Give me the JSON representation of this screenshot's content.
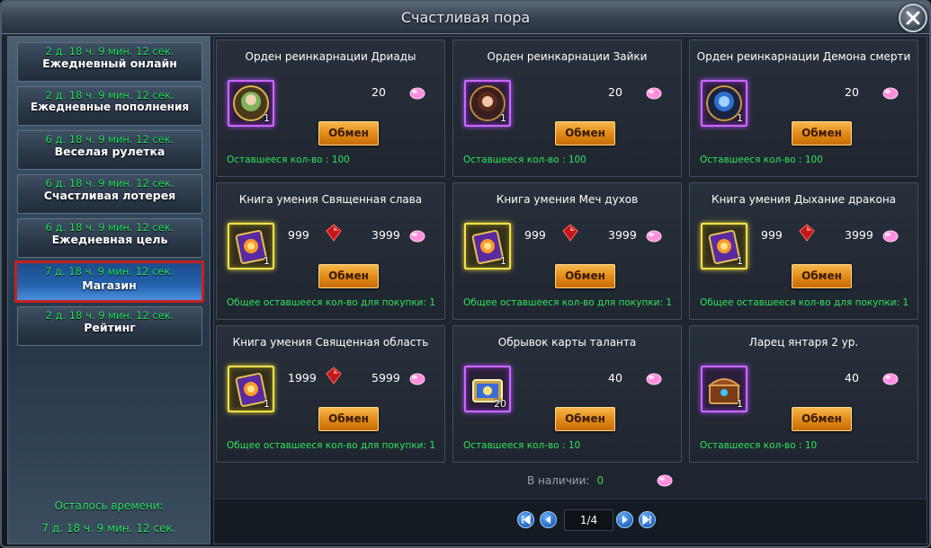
{
  "window": {
    "title": "Счастливая пора"
  },
  "sidebar": {
    "items": [
      {
        "timer": "2 д. 18 ч. 9 мин. 12 сек.",
        "label": "Ежедневный онлайн"
      },
      {
        "timer": "2 д. 18 ч. 9 мин. 12 сек.",
        "label": "Ежедневные пополнения"
      },
      {
        "timer": "6 д. 18 ч. 9 мин. 12 сек.",
        "label": "Веселая рулетка"
      },
      {
        "timer": "6 д. 18 ч. 9 мин. 12 сек.",
        "label": "Счастливая лотерея"
      },
      {
        "timer": "6 д. 18 ч. 9 мин. 12 сек.",
        "label": "Ежедневная цель"
      },
      {
        "timer": "7 д. 18 ч. 9 мин. 12 сек.",
        "label": "Магазин"
      },
      {
        "timer": "2 д. 18 ч. 9 мин. 12 сек.",
        "label": "Рейтинг"
      }
    ],
    "active_index": 5,
    "remaining_label": "Осталось времени:",
    "remaining_value": "7 д. 18 ч. 9 мин. 12 сек."
  },
  "shop": {
    "exchange_label": "Обмен",
    "cards": [
      {
        "title": "Орден реинкарнации Дриады",
        "qty": "1",
        "price_gem": "20",
        "footer": "Оставшееся кол-во : 100",
        "frame": "purple",
        "icon": "dryad-medal-icon"
      },
      {
        "title": "Орден реинкарнации Зайки",
        "qty": "1",
        "price_gem": "20",
        "footer": "Оставшееся кол-во : 100",
        "frame": "purple",
        "icon": "bunny-medal-icon"
      },
      {
        "title": "Орден реинкарнации Демона смерти",
        "qty": "1",
        "price_gem": "20",
        "footer": "Оставшееся кол-во : 100",
        "frame": "purple",
        "icon": "death-demon-medal-icon"
      },
      {
        "title": "Книга умения Священная слава",
        "qty": "1",
        "price_red": "999",
        "price_gem": "3999",
        "footer": "Общее оставшееся кол-во для покупки: 1",
        "frame": "gold",
        "icon": "skill-book-icon"
      },
      {
        "title": "Книга умения Меч духов",
        "qty": "1",
        "price_red": "999",
        "price_gem": "3999",
        "footer": "Общее оставшееся кол-во для покупки: 1",
        "frame": "gold",
        "icon": "skill-book-icon"
      },
      {
        "title": "Книга умения Дыхание дракона",
        "qty": "1",
        "price_red": "999",
        "price_gem": "3999",
        "footer": "Общее оставшееся кол-во для покупки: 1",
        "frame": "gold",
        "icon": "skill-book-icon"
      },
      {
        "title": "Книга умения Священная область",
        "qty": "1",
        "price_red": "1999",
        "price_gem": "5999",
        "footer": "Общее оставшееся кол-во для покупки: 1",
        "frame": "gold",
        "icon": "skill-book-icon"
      },
      {
        "title": "Обрывок карты таланта",
        "qty": "20",
        "price_gem": "40",
        "footer": "Оставшееся кол-во : 10",
        "frame": "purple",
        "icon": "talent-card-fragment-icon"
      },
      {
        "title": "Ларец янтаря 2 ур.",
        "qty": "1",
        "price_gem": "40",
        "footer": "Оставшееся кол-во : 10",
        "frame": "purple",
        "icon": "amber-chest-icon"
      }
    ],
    "available_label": "В наличии:",
    "available_value": "0"
  },
  "pager": {
    "page": "1/4"
  },
  "colors": {
    "accent_green": "#2fe45c",
    "active_border": "#c8201e",
    "button_orange": "#e38c1a"
  }
}
